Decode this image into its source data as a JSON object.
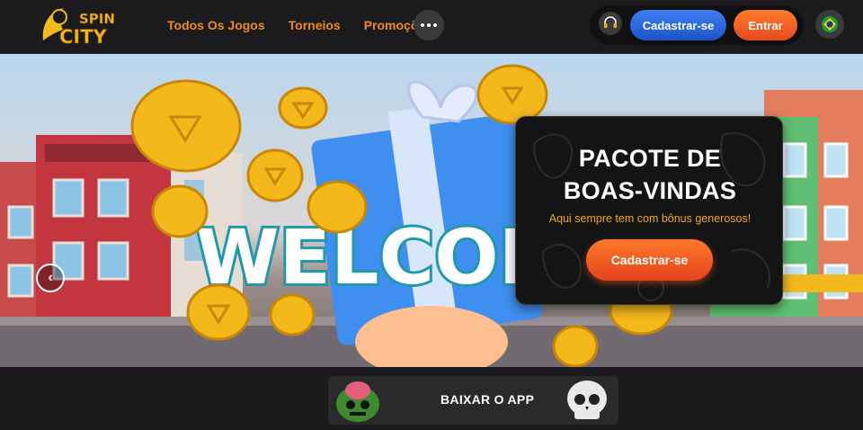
{
  "header": {
    "logo": {
      "line1": "SPIN",
      "line2": "CITY",
      "icon": "spin-city-logo"
    },
    "nav": [
      {
        "label": "Todos Os Jogos"
      },
      {
        "label": "Torneios"
      },
      {
        "label": "Promoções"
      }
    ],
    "more_icon": "more-dots-icon",
    "support_icon": "headset-icon",
    "register_label": "Cadastrar-se",
    "enter_label": "Entrar",
    "language_icon": "brazil-flag-icon"
  },
  "hero": {
    "art_text": "WELCOI",
    "prev_icon": "chevron-left-icon",
    "card": {
      "title": "PACOTE DE BOAS-VINDAS",
      "subtitle": "Aqui sempre tem com bônus generosos!",
      "button_label": "Cadastrar-se"
    }
  },
  "footer": {
    "app_label": "BAIXAR O APP"
  },
  "colors": {
    "nav_text": "#f08a1e",
    "register_blue": "#2a66dd",
    "enter_orange": "#f05f22",
    "card_subtitle": "#f3a81b"
  }
}
